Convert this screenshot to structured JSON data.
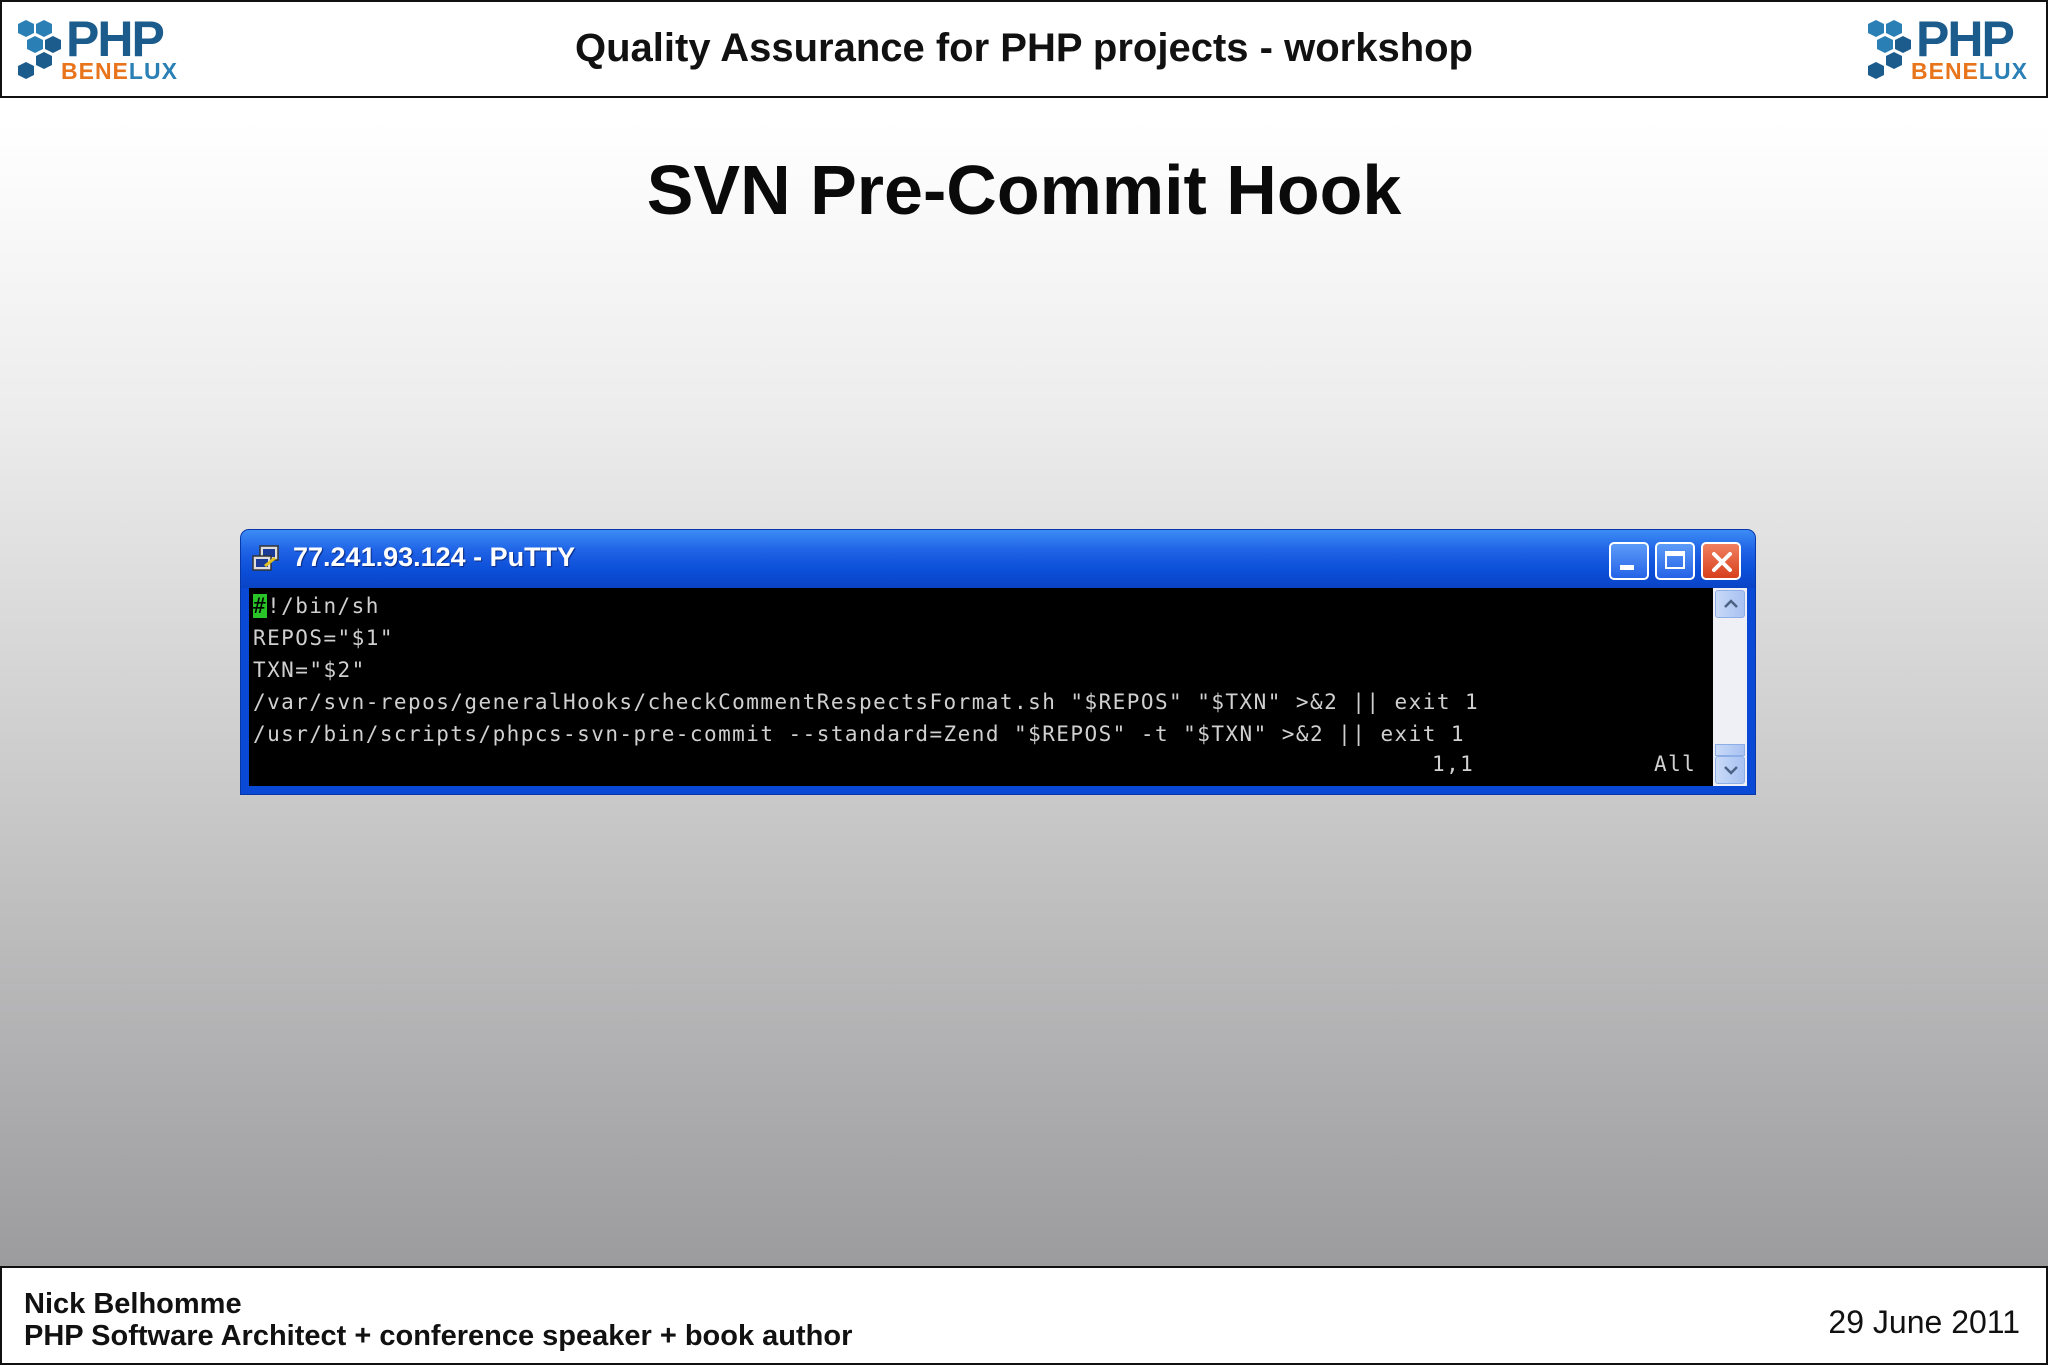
{
  "header": {
    "title": "Quality Assurance for PHP projects - workshop",
    "logo_left": {
      "text_main": "PHP",
      "text_sub_highlight": "BENE",
      "text_sub_rest": "LUX"
    },
    "logo_right": {
      "text_main": "PHP",
      "text_sub_highlight": "BENE",
      "text_sub_rest": "LUX"
    }
  },
  "slide": {
    "title": "SVN Pre-Commit Hook"
  },
  "putty": {
    "window_title": "77.241.93.124 - PuTTY",
    "cursor_char": "#",
    "lines": [
      "!/bin/sh",
      "REPOS=\"$1\"",
      "TXN=\"$2\"",
      "/var/svn-repos/generalHooks/checkCommentRespectsFormat.sh \"$REPOS\" \"$TXN\" >&2 || exit 1",
      "/usr/bin/scripts/phpcs-svn-pre-commit --standard=Zend \"$REPOS\" -t \"$TXN\" >&2 || exit 1"
    ],
    "status_position": "1,1",
    "status_scroll": "All",
    "buttons": {
      "minimize": "minimize-icon",
      "maximize": "maximize-icon",
      "close": "close-icon"
    }
  },
  "footer": {
    "name": "Nick Belhomme",
    "role": "PHP Software Architect + conference speaker + book author",
    "date": "29 June 2011"
  },
  "colors": {
    "titlebar_blue": "#0a49d6",
    "terminal_bg": "#000000",
    "terminal_fg": "#d0d0d0",
    "cursor": "#28c428",
    "logo_blue": "#1c5c8c",
    "logo_orange": "#e8741c"
  }
}
